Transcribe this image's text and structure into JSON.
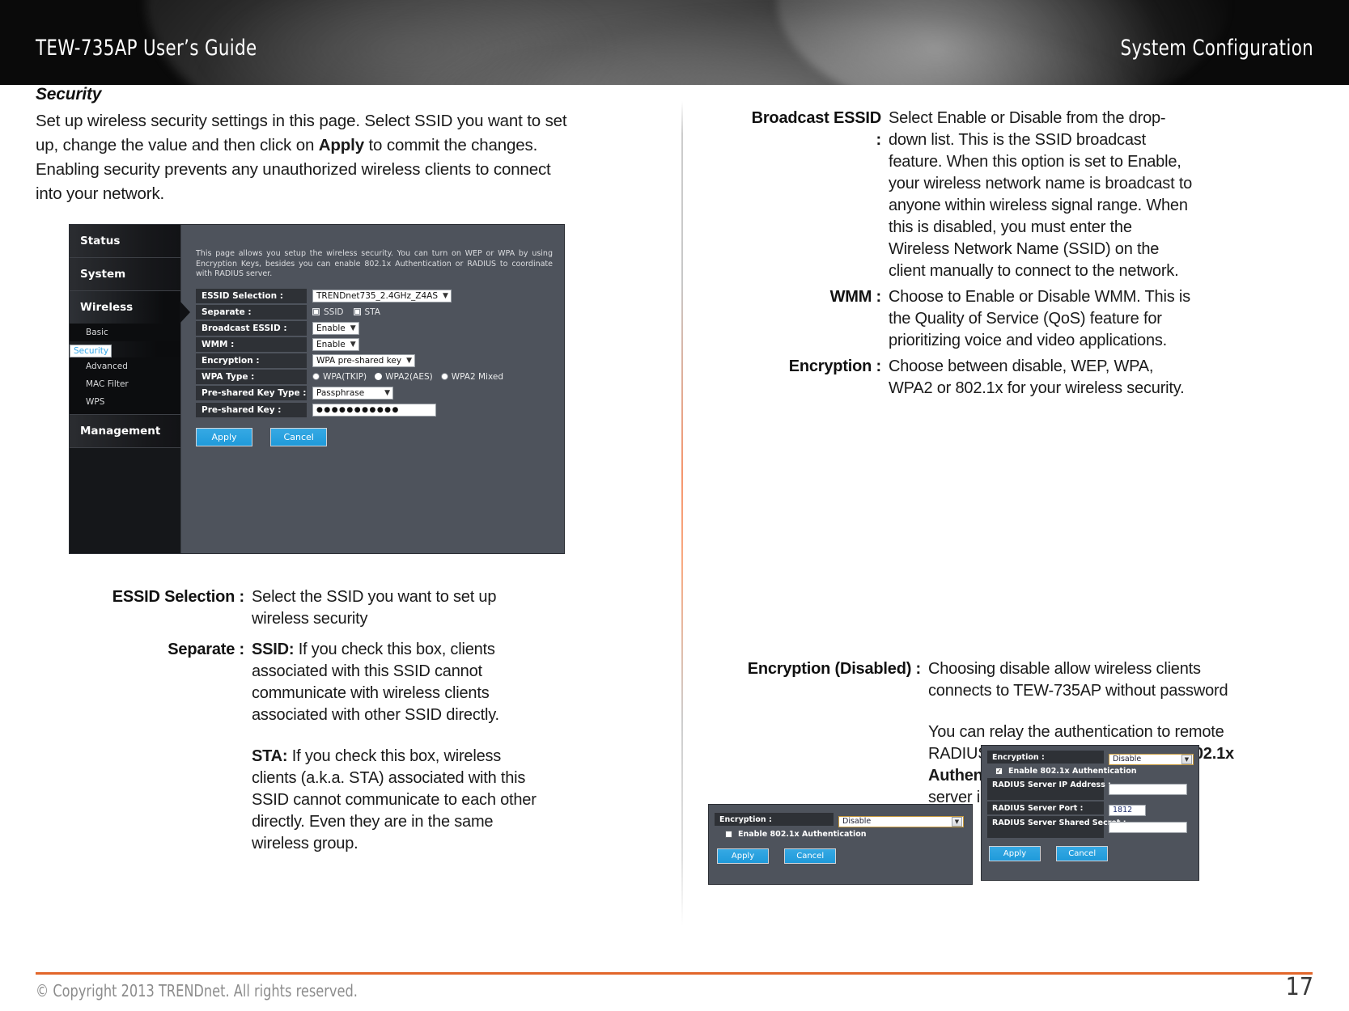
{
  "header": {
    "doc_title": "TEW-735AP User’s Guide",
    "section_title": "System Configuration"
  },
  "left_column": {
    "section_heading": "Security",
    "intro_part1": "Set up wireless security settings in this page. Select SSID you want to set up, change the value and then click on ",
    "intro_bold": "Apply",
    "intro_part2": " to commit the changes. Enabling security prevents any unauthorized wireless clients to connect into your network.",
    "definitions": [
      {
        "term": "ESSID Selection :",
        "desc": "Select the SSID you want to set up wireless security"
      },
      {
        "term": "Separate :",
        "desc_bold1": "SSID:",
        "desc_rest1": " If you check this box, clients associated with this SSID cannot communicate with wireless clients associated with other SSID directly.",
        "desc_bold2": "STA:",
        "desc_rest2": " If you check this box, wireless clients (a.k.a. STA) associated with this SSID cannot communicate to each other directly. Even they are in the same wireless group."
      }
    ]
  },
  "right_column": {
    "definitions": [
      {
        "term": "Broadcast ESSID :",
        "desc": "Select Enable or Disable from the drop-down list. This is the SSID broadcast feature. When this option is set to Enable, your wireless network name is broadcast to anyone within wireless signal range. When this is disabled, you must enter the Wireless Network Name (SSID) on the client manually to connect to the network."
      },
      {
        "term": "WMM :",
        "desc": "Choose to Enable or Disable WMM. This is the Quality of Service (QoS) feature for prioritizing voice and video applications."
      },
      {
        "term": "Encryption :",
        "desc": "Choose between disable, WEP, WPA, WPA2 or 802.1x for your wireless security."
      }
    ],
    "definitions2": [
      {
        "term": "Encryption (Disabled) :",
        "desc1": "Choosing disable allow wireless clients connects to TEW-735AP without password",
        "desc2_a": "You can relay the authentication to remote RADIUS server by checking ",
        "desc2_bold": "Enable 802.1x Authentication",
        "desc2_b": " and entering RADIUS server information."
      }
    ]
  },
  "router_ui": {
    "nav": {
      "items": [
        {
          "label": "Status",
          "type": "main",
          "active": false
        },
        {
          "label": "System",
          "type": "main",
          "active": false
        },
        {
          "label": "Wireless",
          "type": "main",
          "active": true
        },
        {
          "label": "Basic",
          "type": "sub",
          "selected": false
        },
        {
          "label": "Security",
          "type": "sub",
          "selected": true
        },
        {
          "label": "Advanced",
          "type": "sub",
          "selected": false
        },
        {
          "label": "MAC Filter",
          "type": "sub",
          "selected": false
        },
        {
          "label": "WPS",
          "type": "sub",
          "selected": false
        },
        {
          "label": "Management",
          "type": "main",
          "active": false
        }
      ]
    },
    "intro": "This page allows you setup the wireless security. You can turn on WEP or WPA by using Encryption Keys, besides you can enable 802.1x Authentication or RADIUS to coordinate with RADIUS server.",
    "fields": {
      "essid_selection_label": "ESSID Selection :",
      "essid_selection_value": "TRENDnet735_2.4GHz_Z4AS",
      "separate_label": "Separate :",
      "separate_opt1": "SSID",
      "separate_opt2": "STA",
      "broadcast_label": "Broadcast ESSID :",
      "broadcast_value": "Enable",
      "wmm_label": "WMM :",
      "wmm_value": "Enable",
      "encryption_label": "Encryption :",
      "encryption_value": "WPA pre-shared key",
      "wpa_type_label": "WPA Type :",
      "wpa_opt1": "WPA(TKIP)",
      "wpa_opt2": "WPA2(AES)",
      "wpa_opt3": "WPA2 Mixed",
      "psk_type_label": "Pre-shared Key Type :",
      "psk_type_value": "Passphrase",
      "psk_label": "Pre-shared Key :",
      "psk_value": "●●●●●●●●●●●"
    },
    "buttons": {
      "apply": "Apply",
      "cancel": "Cancel"
    }
  },
  "small_shot_1": {
    "encryption_label": "Encryption :",
    "encryption_value": "Disable",
    "checkbox_label": "Enable 802.1x Authentication",
    "checkbox_checked": false,
    "apply": "Apply",
    "cancel": "Cancel"
  },
  "small_shot_2": {
    "encryption_label": "Encryption :",
    "encryption_value": "Disable",
    "checkbox_label": "Enable 802.1x Authentication",
    "checkbox_checked": true,
    "radius_ip_label": "RADIUS Server IP Address :",
    "radius_ip_value": "",
    "radius_port_label": "RADIUS Server Port :",
    "radius_port_value": "1812",
    "radius_secret_label": "RADIUS Server Shared Secret :",
    "radius_secret_value": "",
    "apply": "Apply",
    "cancel": "Cancel"
  },
  "footer": {
    "copyright": "© Copyright 2013 TRENDnet. All rights reserved.",
    "page_number": "17"
  },
  "colors": {
    "accent_orange": "#e2662a",
    "ui_blue_button": "#26a0dc",
    "ui_link_blue": "#35a7e8",
    "ui_panel": "#4e535c"
  }
}
